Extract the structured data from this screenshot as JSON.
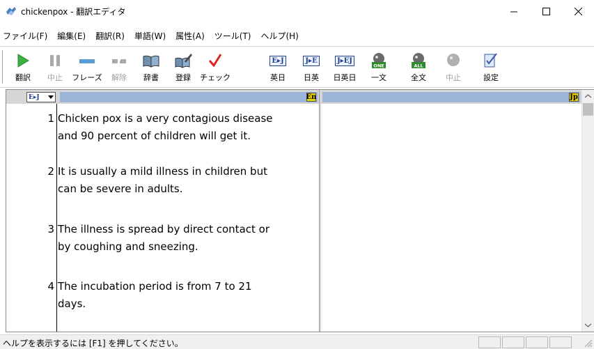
{
  "window": {
    "title": "chickenpox - 翻訳エディタ",
    "minimize_icon": "minimize-icon",
    "maximize_icon": "maximize-icon",
    "close_icon": "close-icon"
  },
  "menu": [
    {
      "label": "ファイル(F)"
    },
    {
      "label": "編集(E)"
    },
    {
      "label": "翻訳(R)"
    },
    {
      "label": "単語(W)"
    },
    {
      "label": "属性(A)"
    },
    {
      "label": "ツール(T)"
    },
    {
      "label": "ヘルプ(H)"
    }
  ],
  "toolbar": {
    "buttons": [
      {
        "label": "翻訳",
        "icon": "play-icon",
        "enabled": true
      },
      {
        "label": "中止",
        "icon": "pause-icon",
        "enabled": false
      },
      {
        "label": "フレーズ",
        "icon": "phrase-icon",
        "enabled": true
      },
      {
        "label": "解除",
        "icon": "unmark-icon",
        "enabled": false
      },
      {
        "label": "辞書",
        "icon": "dictionary-icon",
        "enabled": true
      },
      {
        "label": "登録",
        "icon": "register-icon",
        "enabled": true
      },
      {
        "label": "チェック",
        "icon": "checkmark-icon",
        "enabled": true
      },
      {
        "label": "英日",
        "icon": "en-ja-icon",
        "enabled": true,
        "glyph": "E▸J"
      },
      {
        "label": "日英",
        "icon": "ja-en-icon",
        "enabled": true,
        "glyph": "J▸E"
      },
      {
        "label": "日英日",
        "icon": "ja-en-ja-icon",
        "enabled": true,
        "glyph": "J▸EJ"
      },
      {
        "label": "一文",
        "icon": "one-sentence-icon",
        "enabled": true,
        "badge": "ONE"
      },
      {
        "label": "全文",
        "icon": "all-text-icon",
        "enabled": true,
        "badge": "ALL"
      },
      {
        "label": "中止",
        "icon": "stop-speech-icon",
        "enabled": false
      },
      {
        "label": "設定",
        "icon": "settings-icon",
        "enabled": true
      }
    ]
  },
  "editor": {
    "direction_selector": "E▸J",
    "source_lang_tag": "En",
    "target_lang_tag": "Jp",
    "sentences": [
      {
        "num": "1",
        "lines": [
          "Chicken pox is a very contagious disease",
          "and 90 percent of children will get it."
        ]
      },
      {
        "num": "2",
        "lines": [
          "It is usually a mild illness in children but",
          "can be severe in adults."
        ]
      },
      {
        "num": "3",
        "lines": [
          "The illness is spread by direct contact or",
          "by coughing and sneezing."
        ]
      },
      {
        "num": "4",
        "lines": [
          "The incubation period is from 7 to 21",
          "days."
        ]
      }
    ]
  },
  "status": {
    "text": "ヘルプを表示するには [F1] を押してください。"
  },
  "colors": {
    "play_green": "#3cb043",
    "check_red": "#e02020",
    "lang_bar_blue": "#9db5d9",
    "lang_tag_yellow": "#e8d400"
  }
}
